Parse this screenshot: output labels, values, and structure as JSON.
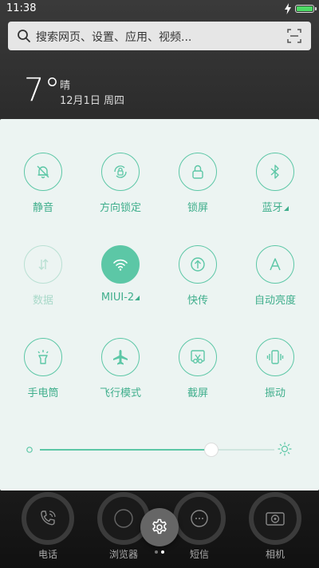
{
  "status_bar": {
    "time": "11:38"
  },
  "search": {
    "placeholder": "搜索网页、设置、应用、视频..."
  },
  "weather": {
    "temperature": "7°",
    "condition": "晴",
    "date": "12月1日 周四"
  },
  "toggles": [
    {
      "label": "静音",
      "icon": "bell-mute-icon",
      "state": "off-outline"
    },
    {
      "label": "方向锁定",
      "icon": "rotation-lock-icon",
      "state": "off-outline"
    },
    {
      "label": "锁屏",
      "icon": "lock-icon",
      "state": "off-outline"
    },
    {
      "label": "蓝牙",
      "icon": "bluetooth-icon",
      "state": "off-outline",
      "has_submenu": true
    },
    {
      "label": "数据",
      "icon": "mobile-data-icon",
      "state": "disabled"
    },
    {
      "label": "MIUI-2",
      "icon": "wifi-icon",
      "state": "on",
      "has_submenu": true
    },
    {
      "label": "快传",
      "icon": "quick-transfer-icon",
      "state": "off-outline"
    },
    {
      "label": "自动亮度",
      "icon": "auto-brightness-icon",
      "state": "off-outline"
    },
    {
      "label": "手电筒",
      "icon": "flashlight-icon",
      "state": "off-outline"
    },
    {
      "label": "飞行模式",
      "icon": "airplane-icon",
      "state": "off-outline"
    },
    {
      "label": "截屏",
      "icon": "screenshot-icon",
      "state": "off-outline"
    },
    {
      "label": "振动",
      "icon": "vibrate-icon",
      "state": "off-outline"
    }
  ],
  "brightness": {
    "level": 0.73
  },
  "dock": [
    {
      "label": "电话",
      "icon": "phone-icon"
    },
    {
      "label": "浏览器",
      "icon": "browser-icon"
    },
    {
      "label": "短信",
      "icon": "messages-icon"
    },
    {
      "label": "相机",
      "icon": "camera-icon"
    }
  ],
  "pager": {
    "pages": 2,
    "current": 2
  },
  "colors": {
    "accent": "#5cc7a6",
    "panel": "#ecf4f2",
    "battery": "#4cd964"
  }
}
